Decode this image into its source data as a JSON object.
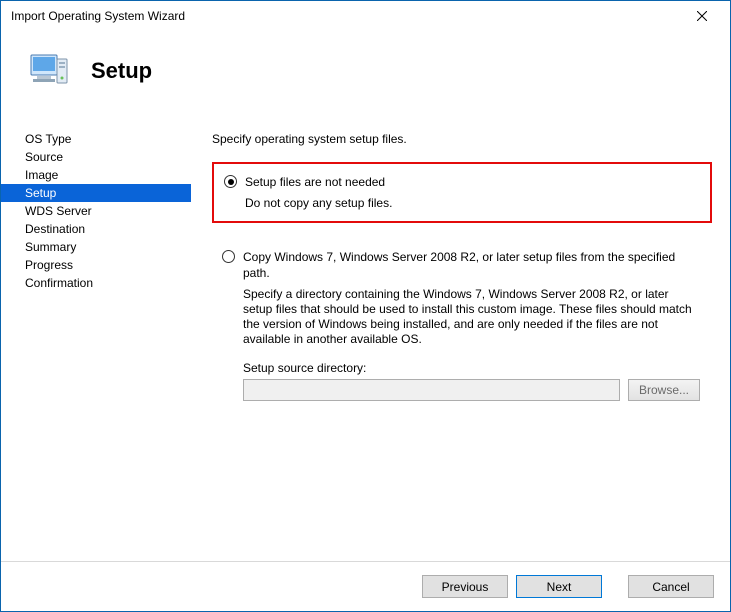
{
  "window": {
    "title": "Import Operating System Wizard"
  },
  "header": {
    "title": "Setup"
  },
  "sidebar": {
    "steps": [
      {
        "label": "OS Type"
      },
      {
        "label": "Source"
      },
      {
        "label": "Image"
      },
      {
        "label": "Setup"
      },
      {
        "label": "WDS Server"
      },
      {
        "label": "Destination"
      },
      {
        "label": "Summary"
      },
      {
        "label": "Progress"
      },
      {
        "label": "Confirmation"
      }
    ],
    "selected_index": 3
  },
  "content": {
    "instruction": "Specify operating system setup files.",
    "option1": {
      "label": "Setup files are not needed",
      "description": "Do not copy any setup files."
    },
    "option2": {
      "label": "Copy Windows 7, Windows Server 2008 R2, or later setup files from the specified path.",
      "description": "Specify a directory containing the Windows 7, Windows Server 2008 R2, or later setup files that should be used to install this custom image.  These files should match the version of Windows being installed, and are only needed if the files are not available in another available OS.",
      "field_label": "Setup source directory:",
      "field_value": "",
      "browse_label": "Browse..."
    }
  },
  "footer": {
    "previous": "Previous",
    "next": "Next",
    "cancel": "Cancel"
  }
}
